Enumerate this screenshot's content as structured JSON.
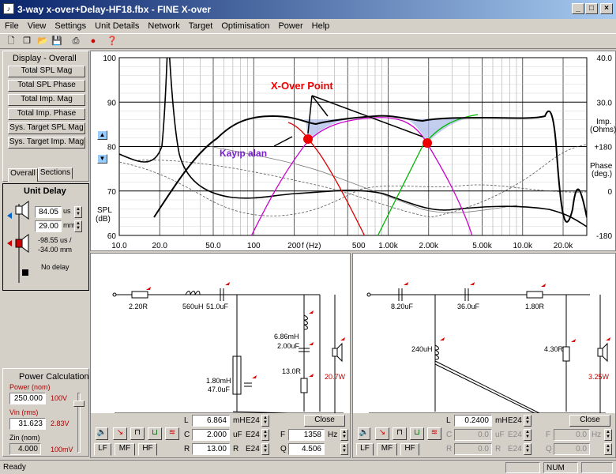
{
  "window": {
    "title": "3-way x-over+Delay-HF18.fbx - FINE X-over"
  },
  "menu": [
    "File",
    "View",
    "Settings",
    "Unit Details",
    "Network",
    "Target",
    "Optimisation",
    "Power",
    "Help"
  ],
  "display_panel": {
    "title": "Display - Overall",
    "buttons": [
      "Total SPL Mag",
      "Total SPL Phase",
      "Total Imp. Mag",
      "Total Imp. Phase",
      "Sys. Target SPL Mag",
      "Sys. Target Imp. Mag"
    ],
    "tabs": [
      "Overall",
      "Sections"
    ]
  },
  "unit_delay": {
    "title": "Unit Delay",
    "delay_us": "84.05",
    "delay_us_unit": "us",
    "delay_mm": "29.00",
    "delay_mm_unit": "mm",
    "readout_us": "-98.55 us /",
    "readout_mm": "-34.00 mm",
    "status": "No delay"
  },
  "power_calc": {
    "title": "Power Calculation",
    "power_label": "Power (nom)",
    "power_value": "250.000",
    "power_volts": "100V",
    "vin_label": "Vin (rms)",
    "vin_value": "31.623",
    "vin_volts": "2.83V",
    "zin_label": "Zin (nom)",
    "zin_value": "4.000",
    "zin_mv": "100mV"
  },
  "chart": {
    "left_axis_title_1": "SPL",
    "left_axis_title_2": "(dB)",
    "left_ticks": [
      "100",
      "90",
      "80",
      "70",
      "60"
    ],
    "right_ticks": [
      "40.0",
      "30.0",
      "+180",
      "0",
      "-180"
    ],
    "right_labels": [
      "Imp.",
      "(Ohms)",
      "Phase",
      "(deg.)"
    ],
    "x_ticks": [
      "10.0",
      "20.0",
      "50.0",
      "100",
      "200",
      "500",
      "1.00k",
      "2.00k",
      "5.00k",
      "10.0k",
      "20.0k"
    ],
    "x_axis_label": "f (Hz)",
    "annotation_xover": "X-Over Point",
    "annotation_loss": "Kayıp alan"
  },
  "lf_network": {
    "components": {
      "r_series": "2.20R",
      "l_series": "560uH",
      "c_series": "51.0uF",
      "l_shunt": "1.80mH",
      "c_shunt": "47.0uF",
      "l_notch": "6.86mH",
      "c_notch": "2.00uF",
      "r_notch": "13.0R",
      "driver_power": "20.7W"
    },
    "editor": {
      "L_label": "L",
      "L_value": "6.864",
      "L_unit": "mH",
      "L_series": "E24",
      "C_label": "C",
      "C_value": "2.000",
      "C_unit": "uF",
      "C_series": "E24",
      "R_label": "R",
      "R_value": "13.00",
      "R_unit": "R",
      "R_series": "E24",
      "F_label": "F",
      "F_value": "1358",
      "F_unit": "Hz",
      "Q_label": "Q",
      "Q_value": "4.506",
      "close": "Close"
    },
    "tabs": [
      "LF",
      "MF",
      "HF"
    ]
  },
  "hf_network": {
    "components": {
      "c1": "8.20uF",
      "c2": "36.0uF",
      "r_series": "1.80R",
      "l_shunt": "240uH",
      "r_shunt": "4.30R",
      "driver_power": "3.25W"
    },
    "editor": {
      "L_label": "L",
      "L_value": "0.2400",
      "L_unit": "mH",
      "L_series": "E24",
      "C_label": "C",
      "C_value": "0.0",
      "C_unit": "uF",
      "C_series": "E24",
      "R_label": "R",
      "R_value": "0.0",
      "R_unit": "R",
      "R_series": "E24",
      "F_label": "F",
      "F_value": "0.0",
      "F_unit": "Hz",
      "Q_label": "Q",
      "Q_value": "0.0",
      "close": "Close"
    },
    "tabs": [
      "LF",
      "MF",
      "HF"
    ]
  },
  "statusbar": {
    "text": "Ready",
    "num": "NUM"
  }
}
